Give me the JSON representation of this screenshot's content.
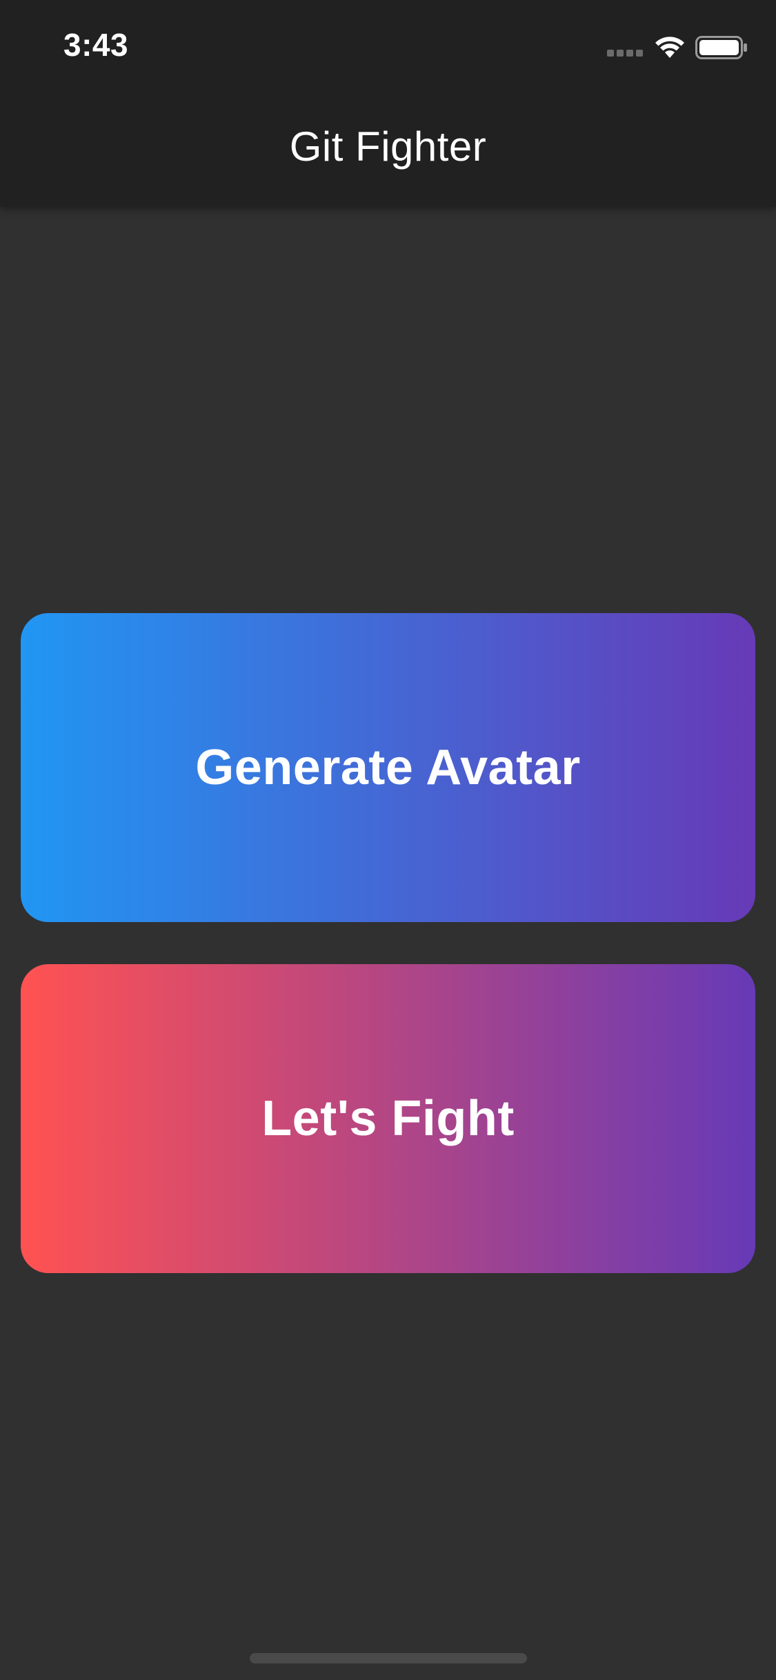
{
  "status_bar": {
    "time": "3:43",
    "signal_icon": "cellular-signal-icon",
    "wifi_icon": "wifi-icon",
    "battery_icon": "battery-icon"
  },
  "app_bar": {
    "title": "Git Fighter"
  },
  "buttons": {
    "generate_avatar": {
      "label": "Generate Avatar",
      "gradient_start": "#2196f3",
      "gradient_end": "#673ab7"
    },
    "lets_fight": {
      "label": "Let's Fight",
      "gradient_start": "#ff5252",
      "gradient_end": "#673ab7"
    }
  },
  "colors": {
    "background": "#303030",
    "app_bar": "#212121",
    "text": "#ffffff"
  }
}
